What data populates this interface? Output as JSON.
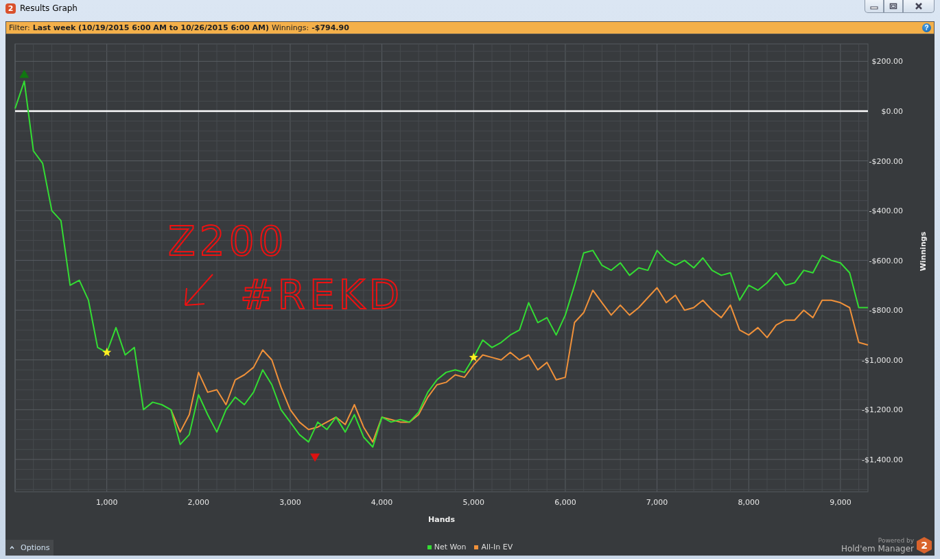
{
  "window": {
    "title": "Results Graph",
    "app_badge": "2"
  },
  "filter_bar": {
    "label": "Filter:",
    "value": "Last week (10/19/2015 6:00 AM to 10/26/2015 6:00 AM)",
    "winnings_label": "Winnings:",
    "winnings_value": "-$794.90",
    "help": "?"
  },
  "graph": {
    "chart_data": {
      "type": "line",
      "xlabel": "Hands",
      "ylabel": "Winnings",
      "x": [
        0,
        100,
        200,
        300,
        400,
        500,
        600,
        700,
        800,
        900,
        1000,
        1100,
        1200,
        1300,
        1400,
        1500,
        1600,
        1700,
        1800,
        1900,
        2000,
        2100,
        2200,
        2300,
        2400,
        2500,
        2600,
        2700,
        2800,
        2900,
        3000,
        3100,
        3200,
        3300,
        3400,
        3500,
        3600,
        3700,
        3800,
        3900,
        4000,
        4100,
        4200,
        4300,
        4400,
        4500,
        4600,
        4700,
        4800,
        4900,
        5000,
        5100,
        5200,
        5300,
        5400,
        5500,
        5600,
        5700,
        5800,
        5900,
        6000,
        6100,
        6200,
        6300,
        6400,
        6500,
        6600,
        6700,
        6800,
        6900,
        7000,
        7100,
        7200,
        7300,
        7400,
        7500,
        7600,
        7700,
        7800,
        7900,
        8000,
        8100,
        8200,
        8300,
        8400,
        8500,
        8600,
        8700,
        8800,
        8900,
        9000,
        9100,
        9200,
        9300
      ],
      "series": [
        {
          "name": "Net Won",
          "color": "#33dd33",
          "values": [
            10,
            120,
            -160,
            -210,
            -400,
            -440,
            -700,
            -680,
            -760,
            -950,
            -970,
            -870,
            -980,
            -950,
            -1200,
            -1170,
            -1180,
            -1200,
            -1340,
            -1300,
            -1140,
            -1220,
            -1290,
            -1200,
            -1150,
            -1180,
            -1130,
            -1040,
            -1100,
            -1200,
            -1250,
            -1300,
            -1330,
            -1250,
            -1280,
            -1230,
            -1290,
            -1220,
            -1310,
            -1350,
            -1230,
            -1250,
            -1240,
            -1250,
            -1210,
            -1130,
            -1080,
            -1050,
            -1040,
            -1050,
            -990,
            -920,
            -950,
            -930,
            -900,
            -880,
            -770,
            -850,
            -830,
            -900,
            -820,
            -700,
            -570,
            -560,
            -620,
            -640,
            -610,
            -660,
            -630,
            -640,
            -560,
            -600,
            -620,
            -600,
            -630,
            -590,
            -640,
            -660,
            -650,
            -760,
            -700,
            -720,
            -690,
            -650,
            -700,
            -690,
            -640,
            -650,
            -580,
            -600,
            -610,
            -650,
            -790,
            -790
          ]
        },
        {
          "name": "All-In EV",
          "color": "#f0913a",
          "values": [
            null,
            null,
            null,
            null,
            null,
            null,
            null,
            null,
            null,
            null,
            null,
            null,
            null,
            null,
            null,
            null,
            null,
            -1200,
            -1290,
            -1220,
            -1050,
            -1130,
            -1120,
            -1180,
            -1080,
            -1060,
            -1030,
            -960,
            -1000,
            -1110,
            -1200,
            -1250,
            -1280,
            -1270,
            -1250,
            -1230,
            -1260,
            -1180,
            -1270,
            -1330,
            -1230,
            -1240,
            -1250,
            -1250,
            -1220,
            -1150,
            -1100,
            -1090,
            -1060,
            -1070,
            -1020,
            -980,
            -990,
            -1000,
            -970,
            -1000,
            -980,
            -1040,
            -1010,
            -1080,
            -1070,
            -850,
            -810,
            -720,
            -770,
            -820,
            -780,
            -820,
            -790,
            -750,
            -710,
            -770,
            -740,
            -800,
            -790,
            -760,
            -800,
            -830,
            -780,
            -880,
            -900,
            -870,
            -910,
            -860,
            -840,
            -840,
            -800,
            -830,
            -760,
            -760,
            -770,
            -790,
            -930,
            -940
          ]
        }
      ],
      "xlim": [
        0,
        9300
      ],
      "ylim": [
        -1530,
        270
      ],
      "xticks": [
        {
          "value": 1000,
          "label": "1,000"
        },
        {
          "value": 2000,
          "label": "2,000"
        },
        {
          "value": 3000,
          "label": "3,000"
        },
        {
          "value": 4000,
          "label": "4,000"
        },
        {
          "value": 5000,
          "label": "5,000"
        },
        {
          "value": 6000,
          "label": "6,000"
        },
        {
          "value": 7000,
          "label": "7,000"
        },
        {
          "value": 8000,
          "label": "8,000"
        },
        {
          "value": 9000,
          "label": "9,000"
        }
      ],
      "yticks": [
        {
          "value": 200,
          "label": "$200.00"
        },
        {
          "value": 0,
          "label": "$0.00"
        },
        {
          "value": -200,
          "label": "-$200.00"
        },
        {
          "value": -400,
          "label": "-$400.00"
        },
        {
          "value": -600,
          "label": "-$600.00"
        },
        {
          "value": -800,
          "label": "-$800.00"
        },
        {
          "value": -1000,
          "label": "-$1,000.00"
        },
        {
          "value": -1200,
          "label": "-$1,200.00"
        },
        {
          "value": -1400,
          "label": "-$1,400.00"
        }
      ],
      "grid": true
    },
    "markers": [
      {
        "kind": "peak"
      },
      {
        "kind": "trough"
      },
      {
        "kind": "star"
      },
      {
        "kind": "star"
      }
    ]
  },
  "handwritten_notes": [
    "Z200",
    "#REKD"
  ],
  "options_button": "Options",
  "branding": {
    "tagline": "Powered by",
    "product": "Hold'em Manager",
    "badge": "2"
  }
}
